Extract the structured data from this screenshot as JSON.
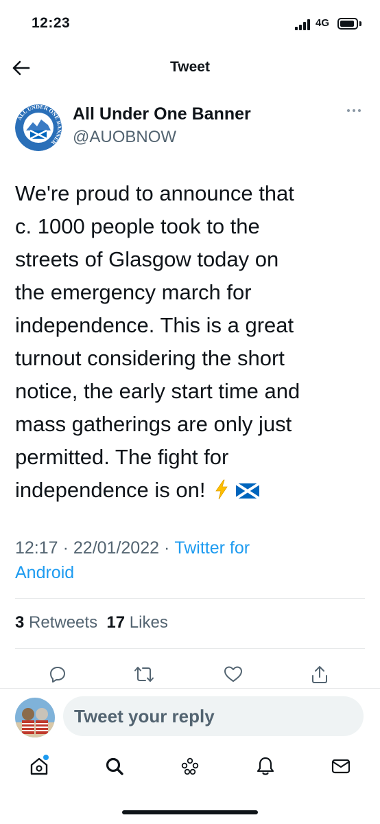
{
  "status_bar": {
    "time": "12:23",
    "network": "4G",
    "battery_level": 0.9
  },
  "header": {
    "title": "Tweet",
    "back_icon": "arrow-left-icon"
  },
  "author": {
    "name": "All Under One Banner",
    "handle": "@AUOBNOW",
    "avatar_text": "ALL UNDER ONE BANNER"
  },
  "tweet": {
    "lines": [
      "We're proud to announce that",
      "c. 1000 people took to the",
      "streets of Glasgow today on",
      "the emergency march for",
      "independence. This is a great",
      "turnout considering the short",
      "notice, the early start time and",
      "mass gatherings are only just",
      "permitted. The fight for",
      "independence is on!"
    ],
    "emojis": [
      "lightning-bolt-emoji",
      "scotland-flag-emoji"
    ]
  },
  "meta": {
    "time": "12:17",
    "separator": "·",
    "date": "22/01/2022",
    "source_line1": "Twitter for",
    "source_line2": "Android"
  },
  "stats": {
    "retweets_count": "3",
    "retweets_label": "Retweets",
    "likes_count": "17",
    "likes_label": "Likes"
  },
  "actions": [
    "reply-icon",
    "retweet-icon",
    "like-icon",
    "share-icon"
  ],
  "reply": {
    "placeholder": "Tweet your reply"
  },
  "bottom_nav": [
    "home-icon",
    "search-icon",
    "spaces-icon",
    "notifications-icon",
    "messages-icon"
  ],
  "colors": {
    "accent": "#1d9bf0",
    "text": "#0f1419",
    "secondary": "#536471",
    "divider": "#e7e9ea",
    "input_bg": "#eff3f4"
  }
}
